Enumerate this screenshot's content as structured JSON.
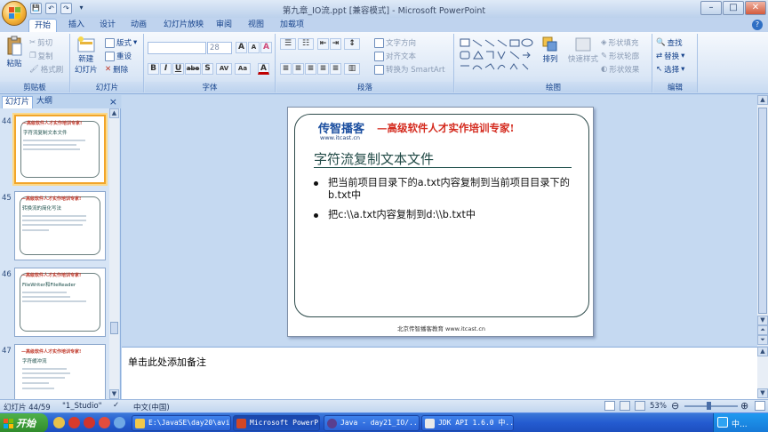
{
  "window": {
    "title": "第九章_IO流.ppt [兼容模式] - Microsoft PowerPoint",
    "controls": {
      "minimize": "–",
      "maximize": "□",
      "close": "✕"
    }
  },
  "quick_access": {
    "save": "💾",
    "undo": "↶",
    "redo": "↷",
    "more": "▾"
  },
  "ribbon": {
    "tabs": [
      "开始",
      "插入",
      "设计",
      "动画",
      "幻灯片放映",
      "审阅",
      "视图",
      "加载项"
    ],
    "active_tab": "开始",
    "clipboard": {
      "label": "剪贴板",
      "paste": "粘贴",
      "cut": "剪切",
      "copy": "复制",
      "format_painter": "格式刷"
    },
    "slides": {
      "label": "幻灯片",
      "new_slide_line1": "新建",
      "new_slide_line2": "幻灯片",
      "layout": "版式",
      "reset": "重设",
      "delete": "删除"
    },
    "font": {
      "label": "字体",
      "font_name": "",
      "font_size": "28",
      "grow": "A",
      "shrink": "A",
      "clear": "A",
      "bold": "B",
      "italic": "I",
      "underline": "U",
      "strike": "abe",
      "shadow": "S",
      "spacing": "AV",
      "case": "Aa",
      "color": "A"
    },
    "paragraph": {
      "label": "段落",
      "text_direction": "文字方向",
      "align_text": "对齐文本",
      "smartart": "转换为 SmartArt"
    },
    "drawing": {
      "label": "绘图",
      "arrange": "排列",
      "quick_styles": "快速样式",
      "shape_fill": "形状填充",
      "shape_outline": "形状轮廓",
      "shape_effects": "形状效果"
    },
    "editing": {
      "label": "编辑",
      "find": "查找",
      "replace": "替换",
      "select": "选择"
    }
  },
  "left_pane": {
    "tabs": [
      "幻灯片",
      "大纲"
    ],
    "close": "×",
    "thumbnails": [
      {
        "number": "44",
        "selected": true,
        "title": "字符流复制文本文件"
      },
      {
        "number": "45",
        "selected": false,
        "title": "转换流的简化写法"
      },
      {
        "number": "46",
        "selected": false,
        "title": "FileWriter和FileReader"
      },
      {
        "number": "47",
        "selected": false,
        "title": "字符缓冲流"
      }
    ],
    "thumb_header": "—高级软件人才实作培训专家!"
  },
  "slide": {
    "logo": "传智播客",
    "logo_url": "www.itcast.cn",
    "slogan": "—高级软件人才实作培训专家!",
    "title": "字符流复制文本文件",
    "bullets": [
      "把当前项目目录下的a.txt内容复制到当前项目目录下的b.txt中",
      "把c:\\\\a.txt内容复制到d:\\\\b.txt中"
    ],
    "footer": "北京传智播客教育 www.itcast.cn"
  },
  "notes": {
    "placeholder": "单击此处添加备注"
  },
  "statusbar": {
    "slide_counter": "幻灯片 44/59",
    "theme": "\"1_Studio\"",
    "language": "中文(中国)",
    "zoom": "53%"
  },
  "taskbar": {
    "start": "开始",
    "items": [
      {
        "label": "E:\\JavaSE\\day20\\avi",
        "active": false
      },
      {
        "label": "Microsoft PowerP...",
        "active": true
      },
      {
        "label": "Java - day21_IO/...",
        "active": false
      },
      {
        "label": "JDK API 1.6.0 中...",
        "active": false
      }
    ],
    "tray_text": "中..."
  },
  "colors": {
    "accent": "#15428b",
    "slogan": "#d42a1e",
    "slide_title": "#214a46",
    "taskbar": "#245bd0"
  }
}
